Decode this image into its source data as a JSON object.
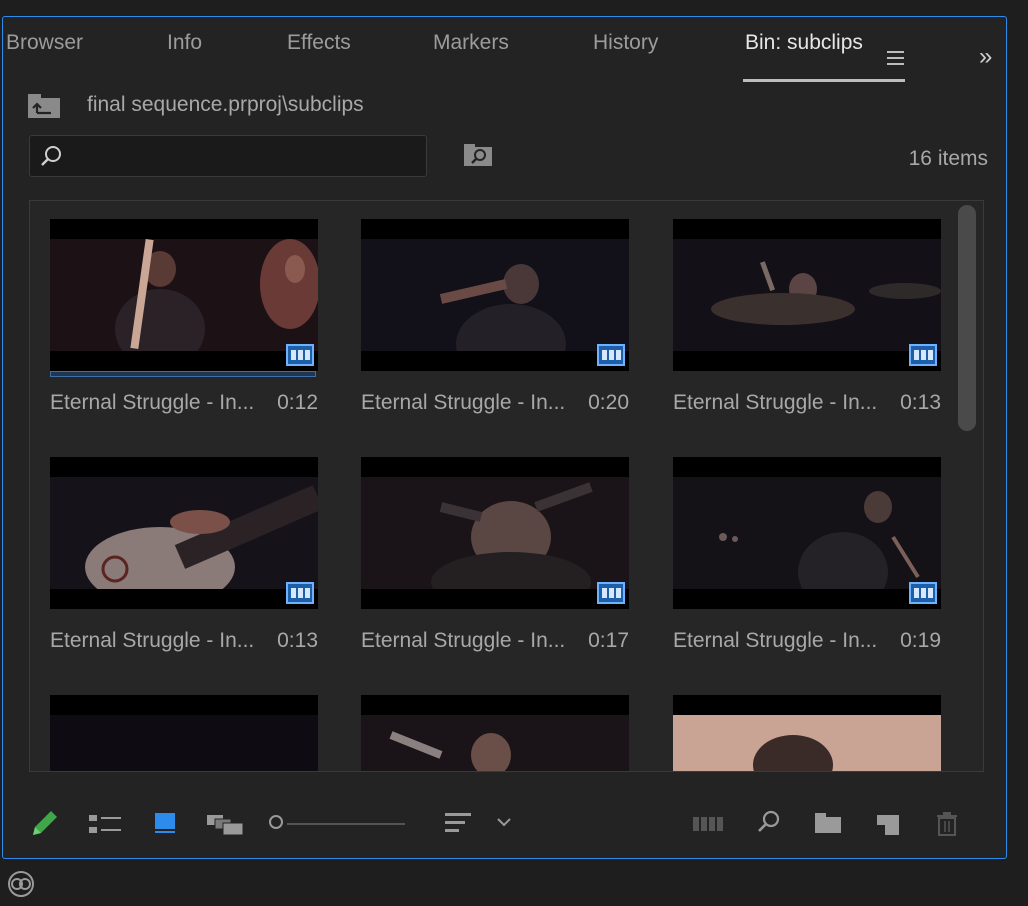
{
  "tabs": [
    {
      "label": "Browser"
    },
    {
      "label": "Info"
    },
    {
      "label": "Effects"
    },
    {
      "label": "Markers"
    },
    {
      "label": "History"
    },
    {
      "label": "Bin: subclips"
    }
  ],
  "active_tab": "Bin: subclips",
  "path": "final sequence.prproj\\subclips",
  "search": {
    "value": "",
    "placeholder": ""
  },
  "item_count": "16 items",
  "clips": [
    {
      "name": "Eternal Struggle - In...",
      "duration": "0:12"
    },
    {
      "name": "Eternal Struggle - In...",
      "duration": "0:20"
    },
    {
      "name": "Eternal Struggle - In...",
      "duration": "0:13"
    },
    {
      "name": "Eternal Struggle - In...",
      "duration": "0:13"
    },
    {
      "name": "Eternal Struggle - In...",
      "duration": "0:17"
    },
    {
      "name": "Eternal Struggle - In...",
      "duration": "0:19"
    },
    {
      "name": "",
      "duration": ""
    },
    {
      "name": "",
      "duration": ""
    },
    {
      "name": "",
      "duration": ""
    }
  ],
  "colors": {
    "accent": "#2d8ceb",
    "badge": "#1d5ea8",
    "pencil": "#3fa64a"
  },
  "toolbar_icons": [
    "pencil-icon",
    "list-view-icon",
    "icon-view-icon",
    "freeform-view-icon",
    "zoom-slider",
    "sort-icon",
    "automate-to-sequence-icon",
    "find-icon",
    "new-bin-icon",
    "new-item-icon",
    "trash-icon"
  ]
}
